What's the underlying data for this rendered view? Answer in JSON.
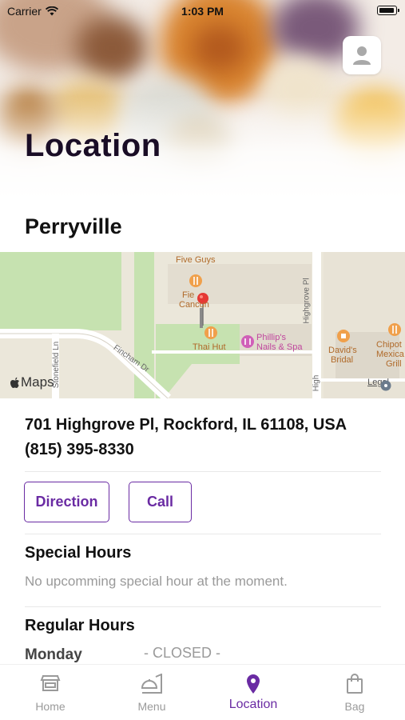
{
  "status_bar": {
    "carrier": "Carrier",
    "time": "1:03 PM"
  },
  "header": {
    "title": "Location"
  },
  "store": {
    "name": "Perryville",
    "address": "701 Highgrove Pl, Rockford, IL 61108, USA",
    "phone": "(815) 395-8330"
  },
  "map": {
    "labels": {
      "five_guys": "Five Guys",
      "fiesta_cancun_1": "Fie",
      "fiesta_cancun_2": "Cancun",
      "thai_hut": "Thai Hut",
      "phillips_1": "Phillip's",
      "phillips_2": "Nails & Spa",
      "davids_1": "David's",
      "davids_2": "Bridal",
      "chipotle_1": "Chipot",
      "chipotle_2": "Mexica",
      "chipotle_3": "Grill",
      "highgrove": "Highgrove Pl",
      "highgrove_short": "High",
      "stonefield": "Stonefield Ln",
      "fincham": "Fincham Dr",
      "maps": "Maps",
      "legal": "Legal"
    }
  },
  "actions": {
    "direction": "Direction",
    "call": "Call"
  },
  "special_hours": {
    "title": "Special Hours",
    "message": "No upcomming special hour at the moment."
  },
  "regular_hours": {
    "title": "Regular Hours",
    "day": "Monday",
    "status": "- CLOSED -"
  },
  "tabs": [
    {
      "label": "Home",
      "icon": "store-icon"
    },
    {
      "label": "Menu",
      "icon": "menu-icon"
    },
    {
      "label": "Location",
      "icon": "location-pin-icon"
    },
    {
      "label": "Bag",
      "icon": "bag-icon"
    }
  ],
  "colors": {
    "accent": "#6a2ba3",
    "pin": "#e53935",
    "poi": "#f0a04b",
    "poi_pink": "#d05fb8",
    "park": "#c6e2b0"
  }
}
